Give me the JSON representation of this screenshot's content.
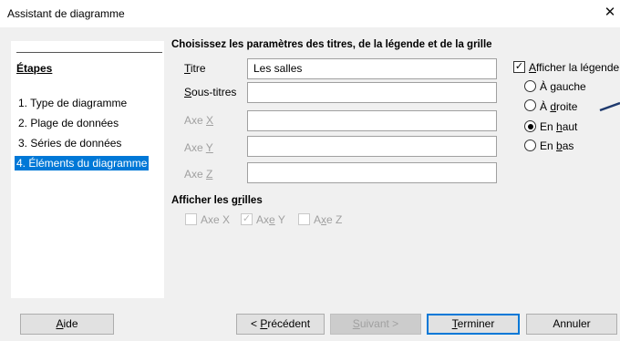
{
  "window": {
    "title": "Assistant de diagramme",
    "close": "✕"
  },
  "steps": {
    "header": "Étapes",
    "items": [
      {
        "label": "1. Type de diagramme",
        "selected": false
      },
      {
        "label": "2. Plage de données",
        "selected": false
      },
      {
        "label": "3. Séries de données",
        "selected": false
      },
      {
        "label": "4. Éléments du diagramme",
        "selected": true
      }
    ]
  },
  "titles": {
    "section": "Choisissez les paramètres des titres, de la légende et de la grille",
    "fields": {
      "title": {
        "label": "Titre",
        "value": "Les salles"
      },
      "subtitle": {
        "label": "Sous-titres",
        "value": ""
      },
      "x": {
        "label": "Axe X",
        "value": ""
      },
      "y": {
        "label": "Axe Y",
        "value": ""
      },
      "z": {
        "label": "Axe Z",
        "value": ""
      }
    }
  },
  "legend": {
    "show_label": "Afficher la légende",
    "show": true,
    "options": [
      {
        "label": "À gauche",
        "checked": false
      },
      {
        "label": "À droite",
        "checked": false
      },
      {
        "label": "En haut",
        "checked": true
      },
      {
        "label": "En bas",
        "checked": false
      }
    ]
  },
  "grids": {
    "section": "Afficher les grilles",
    "x": {
      "label": "Axe X",
      "checked": false
    },
    "y": {
      "label": "Axe Y",
      "checked": true
    },
    "z": {
      "label": "Axe Z",
      "checked": false
    }
  },
  "buttons": {
    "help": "Aide",
    "previous": "< Précédent",
    "next": "Suivant >",
    "finish": "Terminer",
    "cancel": "Annuler"
  },
  "colors": {
    "selection": "#0078d7",
    "arrow": "#1f3a6e"
  }
}
